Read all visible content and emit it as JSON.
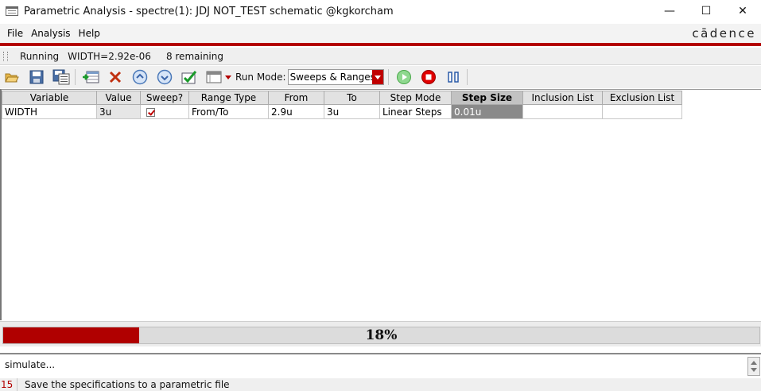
{
  "window": {
    "title": "Parametric Analysis - spectre(1): JDJ NOT_TEST schematic @kgkorcham",
    "controls": {
      "minimize": "—",
      "maximize": "☐",
      "close": "✕"
    }
  },
  "menu": {
    "file": "File",
    "analysis": "Analysis",
    "help": "Help"
  },
  "brand": "cādence",
  "status": {
    "state": "Running",
    "param": "WIDTH=2.92e-06",
    "remaining": "8 remaining"
  },
  "toolbar": {
    "run_mode_label": "Run Mode:",
    "run_mode_value": "Sweeps & Ranges",
    "icons": [
      "open-folder-icon",
      "save-icon",
      "save-as-icon",
      "add-row-icon",
      "delete-icon",
      "move-up-icon",
      "move-down-icon",
      "check-icon",
      "table-view-icon",
      "dropdown-icon",
      "run-icon",
      "stop-icon",
      "pause-icon"
    ]
  },
  "table": {
    "headers": [
      "Variable",
      "Value",
      "Sweep?",
      "Range Type",
      "From",
      "To",
      "Step Mode",
      "Step Size",
      "Inclusion List",
      "Exclusion List"
    ],
    "rows": [
      {
        "variable": "WIDTH",
        "value": "3u",
        "sweep": true,
        "range_type": "From/To",
        "from": "2.9u",
        "to": "3u",
        "step_mode": "Linear Steps",
        "step_size": "0.01u",
        "inclusion_list": "",
        "exclusion_list": ""
      }
    ]
  },
  "progress": {
    "percent_label": "18%",
    "fraction": 0.18
  },
  "log": {
    "text": "simulate..."
  },
  "hint": {
    "number": "15",
    "text": "Save the specifications to a parametric file"
  },
  "colors": {
    "accent": "#b30000",
    "progress_fill": "#b00000",
    "header": "#e2e2e2",
    "selected_cell": "#8a8a8a"
  }
}
